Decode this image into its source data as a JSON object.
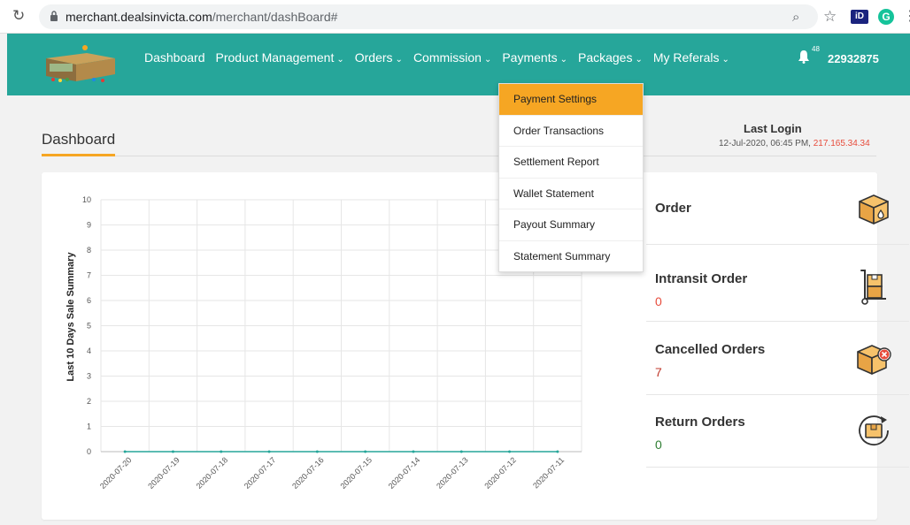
{
  "browser": {
    "url_host": "merchant.dealsinvicta.com",
    "url_path": "/merchant/dashBoard#",
    "ext_id_label": "iD",
    "ext_g_label": "G"
  },
  "nav": {
    "items": [
      {
        "label": "Dashboard",
        "has_menu": false
      },
      {
        "label": "Product Management",
        "has_menu": true
      },
      {
        "label": "Orders",
        "has_menu": true
      },
      {
        "label": "Commission",
        "has_menu": true
      },
      {
        "label": "Payments",
        "has_menu": true
      },
      {
        "label": "Packages",
        "has_menu": true
      },
      {
        "label": "My Referals",
        "has_menu": true
      }
    ],
    "notification_count": "48",
    "user_id": "22932875",
    "bg_color": "#26a69a"
  },
  "payments_menu": {
    "items": [
      "Payment Settings",
      "Order Transactions",
      "Settlement Report",
      "Wallet Statement",
      "Payout Summary",
      "Statement Summary"
    ],
    "active_index": 0
  },
  "page": {
    "title": "Dashboard",
    "last_login_label": "Last Login",
    "last_login_datetime": "12-Jul-2020,  06:45 PM,",
    "last_login_ip": "217.165.34.34"
  },
  "stats": [
    {
      "label": "Order",
      "value": "",
      "value_color": "#e74c3c",
      "icon": "box-drop-icon"
    },
    {
      "label": "Intransit Order",
      "value": "0",
      "value_color": "#e74c3c",
      "icon": "hand-truck-icon"
    },
    {
      "label": "Cancelled Orders",
      "value": "7",
      "value_color": "#c0392b",
      "icon": "box-cancel-icon"
    },
    {
      "label": "Return Orders",
      "value": "0",
      "value_color": "#2e7d32",
      "icon": "box-return-icon"
    }
  ],
  "chart_data": {
    "type": "line",
    "ylabel": "Last 10 Days Sale Summary",
    "xlabel": "",
    "categories": [
      "2020-07-20",
      "2020-07-19",
      "2020-07-18",
      "2020-07-17",
      "2020-07-16",
      "2020-07-15",
      "2020-07-14",
      "2020-07-13",
      "2020-07-12",
      "2020-07-11"
    ],
    "series": [
      {
        "values": [
          0,
          0,
          0,
          0,
          0,
          0,
          0,
          0,
          0,
          0
        ]
      }
    ],
    "ylim": [
      0,
      10
    ],
    "yticks": [
      0,
      1,
      2,
      3,
      4,
      5,
      6,
      7,
      8,
      9,
      10
    ],
    "grid": true
  }
}
